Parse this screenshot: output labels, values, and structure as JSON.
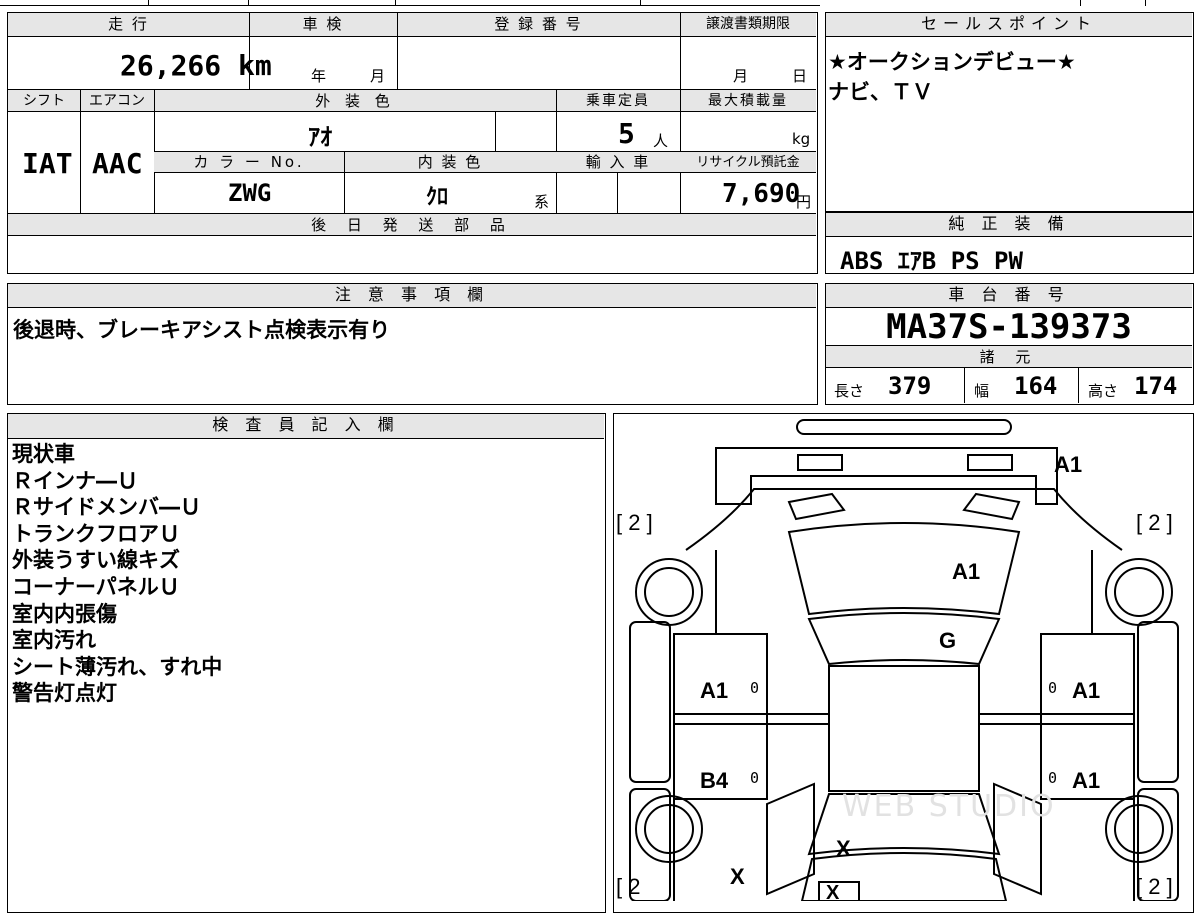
{
  "top_header": {
    "mileage_label": "走 行",
    "shaken_label": "車 検",
    "registration_label": "登 録 番 号",
    "transfer_deadline_label": "譲渡書類期限",
    "sales_point_label": "セールスポイント"
  },
  "mileage": {
    "value": "26,266",
    "unit": "km"
  },
  "shaken": {
    "year_unit": "年",
    "month_unit": "月"
  },
  "transfer_deadline": {
    "month_unit": "月",
    "day_unit": "日"
  },
  "labels": {
    "shift": "シフト",
    "aircon": "エアコン",
    "exterior_color": "外 装 色",
    "capacity": "乗車定員",
    "max_load": "最大積載量",
    "color_no": "カ ラ ー No.",
    "interior_color": "内 装 色",
    "import": "輸 入 車",
    "recycle": "リサイクル預託金",
    "later_parts": "後 日 発 送 部 品",
    "genuine_equipment": "純 正 装 備",
    "notes": "注 意 事 項 欄",
    "chassis_number": "車 台 番 号",
    "specs": "諸 元",
    "inspector": "検 査 員 記 入 欄"
  },
  "vehicle": {
    "shift": "IAT",
    "aircon": "AAC",
    "exterior_color": "ｱｵ",
    "capacity": "5",
    "capacity_unit": "人",
    "max_load_unit": "kg",
    "color_no": "ZWG",
    "interior_color": "ｸﾛ",
    "interior_suffix": "系",
    "recycle_fee": "7,690",
    "recycle_unit": "円"
  },
  "sales_points": [
    "★オークションデビュー★",
    "ナビ、ＴＶ"
  ],
  "genuine_equipment": "ABS ｴｱB PS PW",
  "notes": "後退時、ブレーキアシスト点検表示有り",
  "chassis_number": "MA37S-139373",
  "specs": {
    "length_label": "長さ",
    "length": "379",
    "width_label": "幅",
    "width": "164",
    "height_label": "高さ",
    "height": "174"
  },
  "inspector_notes": [
    "現状車",
    "Ｒインナ―Ｕ",
    "Ｒサイドメンバ―Ｕ",
    "トランクフロアＵ",
    "外装うすい線キズ",
    "コーナーパネルＵ",
    "室内内張傷",
    "室内汚れ",
    "シート薄汚れ、すれ中",
    "警告灯点灯"
  ],
  "diagram": {
    "tire_left_top": "[ 2 ]",
    "tire_right_top": "[ 2 ]",
    "tire_left_bottom": "[ 2",
    "tire_right_bottom": "[ 2 ]",
    "front_bumper": "A1",
    "hood": "A1",
    "windshield": "G",
    "left_front_door": "A1",
    "left_rear_door": "B4",
    "right_front_door": "A1",
    "right_rear_door": "A1",
    "left_rear_quarter": "X",
    "rear_hatch": "X",
    "rear_bumper": "X",
    "door_marks": [
      "0",
      "0",
      "0",
      "0"
    ],
    "watermark": "WEB STUDIO"
  }
}
